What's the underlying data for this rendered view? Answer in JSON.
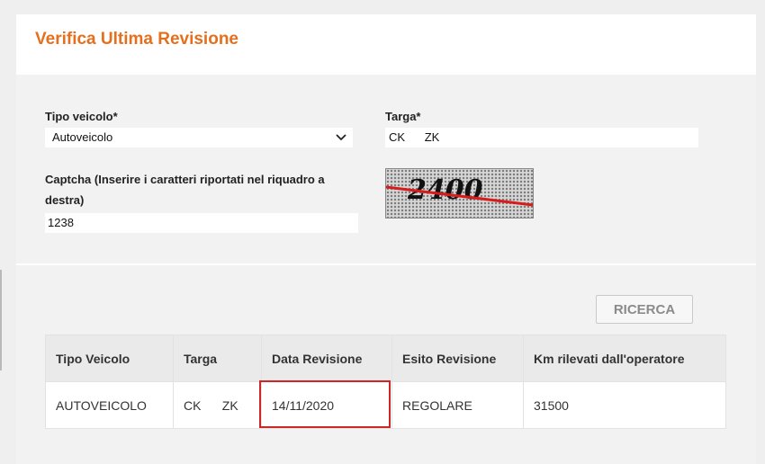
{
  "header": {
    "title": "Verifica Ultima Revisione"
  },
  "form": {
    "vehicle_type": {
      "label": "Tipo veicolo*",
      "value": "Autoveicolo",
      "icon": "chevron-down-icon"
    },
    "plate": {
      "label": "Targa*",
      "value": "CK      ZK"
    },
    "captcha": {
      "label": "Captcha (Inserire i caratteri riportati nel riquadro a destra)",
      "value": "1238",
      "image_text": "2400"
    },
    "search_label": "RICERCA"
  },
  "results": {
    "columns": [
      "Tipo Veicolo",
      "Targa",
      "Data Revisione",
      "Esito Revisione",
      "Km rilevati dall'operatore"
    ],
    "rows": [
      [
        "AUTOVEICOLO",
        "CK      ZK",
        "14/11/2020",
        "REGOLARE",
        "31500"
      ]
    ]
  },
  "colors": {
    "title": "#e4701e",
    "highlight": "#cc2626"
  }
}
